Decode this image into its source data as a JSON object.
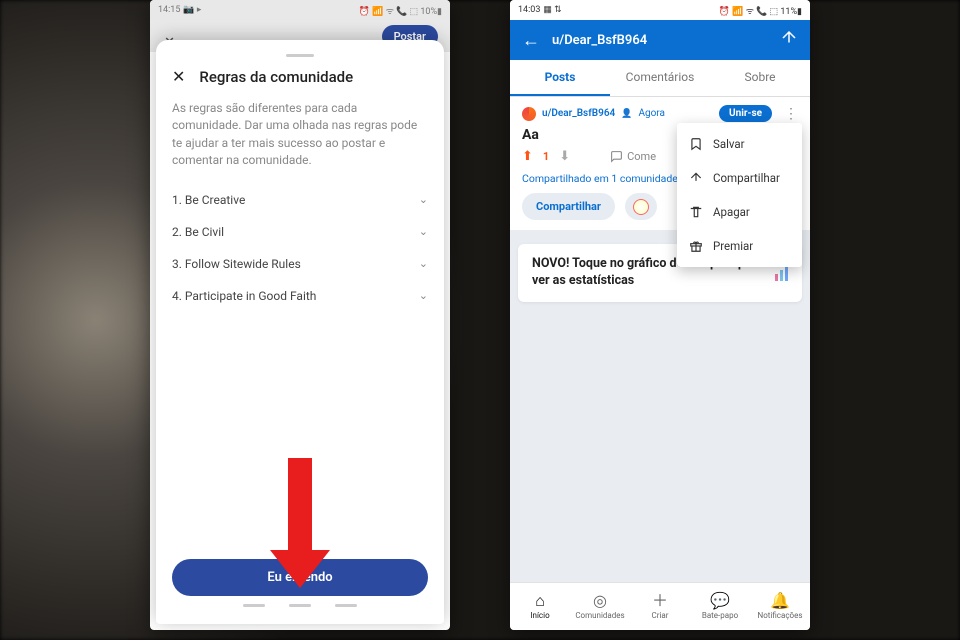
{
  "phone1": {
    "status": {
      "time": "14:15",
      "left_icons": "📷 ▸",
      "right_icons": "⏰ 📶 ᯤ 📞 ⬚ 10%▮"
    },
    "header": {
      "postar": "Postar"
    },
    "sheet": {
      "title": "Regras da comunidade",
      "desc": "As regras são diferentes para cada comunidade. Dar uma olhada nas regras pode te ajudar a ter mais sucesso ao postar e comentar na comunidade.",
      "rules": [
        "1. Be Creative",
        "2. Be Civil",
        "3. Follow Sitewide Rules",
        "4. Participate in Good Faith"
      ],
      "cta": "Eu entendo"
    }
  },
  "phone2": {
    "status": {
      "time": "14:03",
      "left_icons": "▦ ⇅",
      "right_icons": "⏰ 📶 ᯤ 📞 ⬚ 11%▮"
    },
    "topbar": {
      "title": "u/Dear_BsfB964"
    },
    "tabs": {
      "posts": "Posts",
      "coment": "Comentários",
      "sobre": "Sobre"
    },
    "post": {
      "user": "u/Dear_BsfB964",
      "time": "Agora",
      "join": "Unir-se",
      "title": "Aa",
      "votes": "1",
      "comment_label": "Come",
      "shared_in": "Compartilhado em 1 comunidade",
      "share_chip": "Compartilhar"
    },
    "menu": {
      "save": "Salvar",
      "share": "Compartilhar",
      "delete": "Apagar",
      "award": "Premiar"
    },
    "stats_card": "NOVO! Toque no gráfico do seu post para ver as estatísticas",
    "nav": {
      "home": "Início",
      "comm": "Comunidades",
      "create": "Criar",
      "chat": "Bate-papo",
      "notif": "Notificações"
    }
  }
}
